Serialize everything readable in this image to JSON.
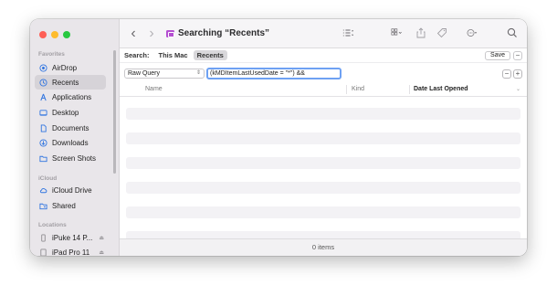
{
  "sidebar": {
    "sections": [
      {
        "label": "Favorites"
      },
      {
        "label": "iCloud"
      },
      {
        "label": "Locations"
      }
    ],
    "items": [
      {
        "label": "AirDrop",
        "icon": "airdrop-icon"
      },
      {
        "label": "Recents",
        "icon": "clock-icon",
        "selected": true
      },
      {
        "label": "Applications",
        "icon": "applications-icon"
      },
      {
        "label": "Desktop",
        "icon": "desktop-icon"
      },
      {
        "label": "Documents",
        "icon": "document-icon"
      },
      {
        "label": "Downloads",
        "icon": "download-icon"
      },
      {
        "label": "Screen Shots",
        "icon": "folder-icon"
      },
      {
        "label": "iCloud Drive",
        "icon": "cloud-icon"
      },
      {
        "label": "Shared",
        "icon": "shared-folder-icon"
      },
      {
        "label": "iPuke 14 P...",
        "icon": "phone-icon"
      },
      {
        "label": "iPad Pro 11",
        "icon": "tablet-icon"
      }
    ],
    "eject_glyph": "⏏"
  },
  "toolbar": {
    "title": "Searching “Recents”",
    "back_glyph": "‹",
    "forward_glyph": "›",
    "view_options_glyph": "⌄"
  },
  "scope": {
    "label": "Search:",
    "options": [
      "This Mac",
      "Recents"
    ],
    "active": "Recents",
    "save_label": "Save",
    "minus_glyph": "−"
  },
  "criteria": {
    "attribute": "Raw Query",
    "query_value": "(kMDItemLastUsedDate = \"*\") &&",
    "minus_glyph": "−",
    "plus_glyph": "+"
  },
  "columns": {
    "name": "Name",
    "kind": "Kind",
    "date_last_opened": "Date Last Opened"
  },
  "status": {
    "item_count": "0 items"
  },
  "colors": {
    "accent": "#2f74e0",
    "selection": "#d6d3d8",
    "focus_ring": "#6ea1f3",
    "folder_purple": "#b44fd1"
  }
}
